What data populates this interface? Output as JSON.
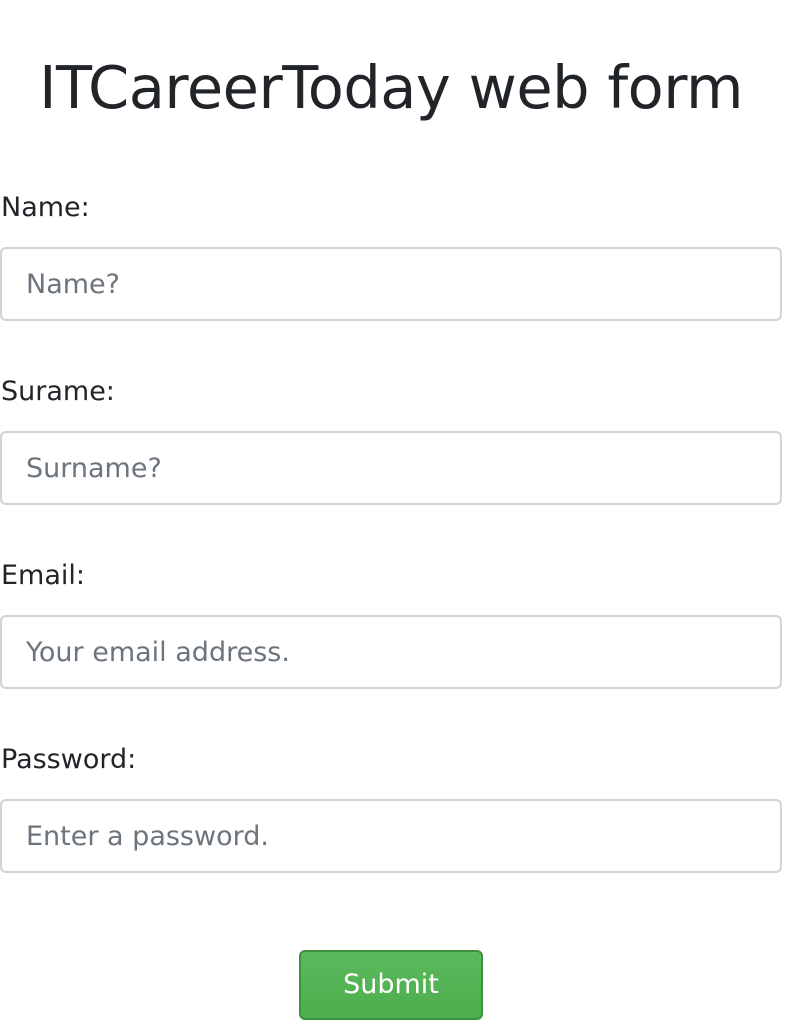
{
  "page": {
    "title": "ITCareerToday web form"
  },
  "form": {
    "name": {
      "label": "Name:",
      "value": "",
      "placeholder": "Name?"
    },
    "surname": {
      "label": "Surame:",
      "value": "",
      "placeholder": "Surname?"
    },
    "email": {
      "label": "Email:",
      "value": "",
      "placeholder": "Your email address."
    },
    "password": {
      "label": "Password:",
      "value": "",
      "placeholder": "Enter a password."
    },
    "submit_label": "Submit"
  },
  "colors": {
    "submit_button": "#5cb85c",
    "input_border": "#ced4da",
    "text": "#212529",
    "placeholder": "#6c757d"
  }
}
